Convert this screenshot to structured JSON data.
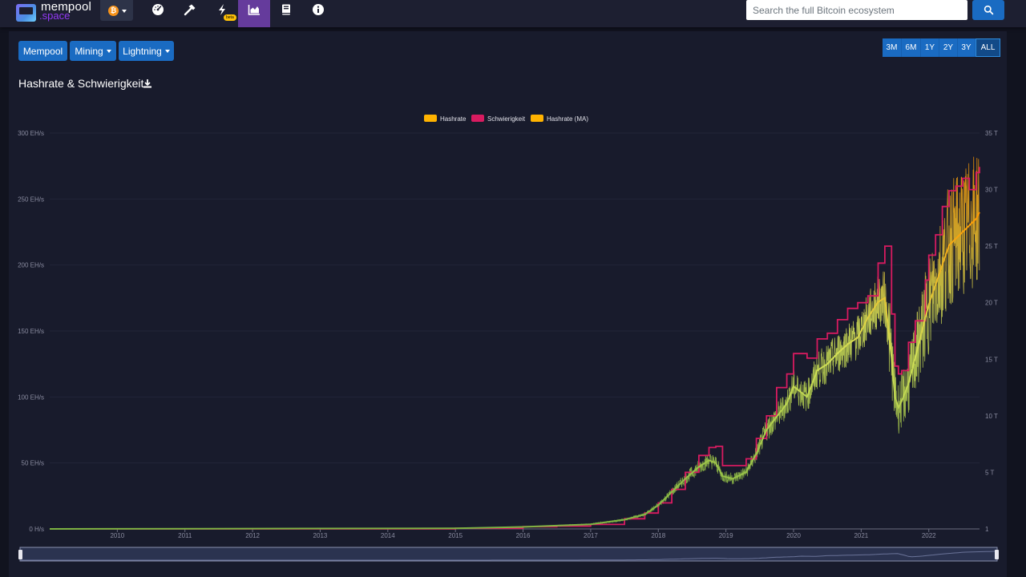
{
  "brand": {
    "name_line1": "mempool",
    "name_line2": ".space"
  },
  "nav": {
    "network_icon_label": "₿",
    "beta_label": "beta"
  },
  "icons": {
    "dashboard": "gauge-icon",
    "mining": "hammer-icon",
    "lightning": "bolt-icon",
    "graphs": "area-chart-icon",
    "docs": "book-icon",
    "about": "info-icon",
    "search": "search-icon",
    "download": "download-icon"
  },
  "search": {
    "placeholder": "Search the full Bitcoin ecosystem"
  },
  "menus": {
    "mempool": "Mempool",
    "mining": "Mining",
    "lightning": "Lightning"
  },
  "ranges": [
    "3M",
    "6M",
    "1Y",
    "2Y",
    "3Y",
    "ALL"
  ],
  "active_range": "ALL",
  "colors": {
    "hashrate": "#ffb300",
    "difficulty": "#d81b60",
    "ma_start": "#7cb342",
    "ma_end": "#ff9800",
    "nav_active": "#653b9c",
    "button": "#1a6bc2"
  },
  "chart_data": {
    "type": "line",
    "title": "Hashrate & Schwierigkeit",
    "legend": [
      "Hashrate",
      "Schwierigkeit",
      "Hashrate (MA)"
    ],
    "legend_position": "top-center",
    "x_ticks": [
      "2010",
      "2011",
      "2012",
      "2013",
      "2014",
      "2015",
      "2016",
      "2017",
      "2018",
      "2019",
      "2020",
      "2021",
      "2022"
    ],
    "y_left_ticks": [
      "0 H/s",
      "50 EH/s",
      "100 EH/s",
      "150 EH/s",
      "200 EH/s",
      "250 EH/s",
      "300 EH/s"
    ],
    "y_right_ticks": [
      "1",
      "5 T",
      "10 T",
      "15 T",
      "20 T",
      "25 T",
      "30 T",
      "35 T"
    ],
    "y_left_range": [
      0,
      300
    ],
    "y_right_range": [
      0,
      35
    ],
    "x_range": [
      2009.0,
      2022.75
    ],
    "hashrate_ma": {
      "name": "Hashrate (MA)",
      "unit": "EH/s",
      "x": [
        2009.0,
        2015.0,
        2016.0,
        2016.5,
        2017.0,
        2017.5,
        2017.8,
        2018.0,
        2018.2,
        2018.4,
        2018.6,
        2018.75,
        2018.85,
        2018.95,
        2019.1,
        2019.3,
        2019.45,
        2019.6,
        2019.75,
        2019.9,
        2020.0,
        2020.2,
        2020.35,
        2020.5,
        2020.65,
        2020.8,
        2020.95,
        2021.1,
        2021.25,
        2021.35,
        2021.45,
        2021.5,
        2021.55,
        2021.6,
        2021.7,
        2021.8,
        2021.95,
        2022.0,
        2022.1,
        2022.2,
        2022.3,
        2022.4,
        2022.5,
        2022.6,
        2022.7,
        2022.75
      ],
      "y": [
        0,
        0.4,
        1.5,
        2.5,
        3.5,
        7,
        11,
        18,
        28,
        38,
        47,
        52,
        50,
        40,
        38,
        43,
        57,
        75,
        85,
        95,
        108,
        100,
        120,
        125,
        133,
        140,
        145,
        160,
        172,
        175,
        130,
        100,
        92,
        97,
        110,
        130,
        160,
        170,
        185,
        200,
        215,
        220,
        225,
        230,
        235,
        240
      ]
    },
    "difficulty": {
      "name": "Schwierigkeit",
      "unit": "T",
      "x": [
        2009.0,
        2015.0,
        2016.0,
        2016.5,
        2017.0,
        2017.5,
        2017.8,
        2018.0,
        2018.2,
        2018.4,
        2018.6,
        2018.75,
        2018.85,
        2018.95,
        2019.1,
        2019.3,
        2019.45,
        2019.6,
        2019.75,
        2019.9,
        2020.0,
        2020.2,
        2020.35,
        2020.5,
        2020.65,
        2020.8,
        2020.95,
        2021.1,
        2021.25,
        2021.35,
        2021.45,
        2021.5,
        2021.55,
        2021.6,
        2021.7,
        2021.8,
        2021.95,
        2022.0,
        2022.1,
        2022.2,
        2022.3,
        2022.4,
        2022.5,
        2022.6,
        2022.7,
        2022.75
      ],
      "y": [
        0,
        0.06,
        0.2,
        0.25,
        0.4,
        0.9,
        1.4,
        2.3,
        3.5,
        5,
        6.5,
        7.2,
        7.3,
        5.6,
        5.6,
        6.2,
        8.0,
        10.0,
        12.5,
        13.7,
        15.5,
        15.1,
        16.8,
        17.3,
        18.5,
        19.5,
        20.0,
        20.6,
        23.5,
        25.0,
        19.0,
        14.4,
        13.7,
        14.0,
        16.5,
        18.4,
        22.0,
        24.2,
        26.0,
        28.5,
        29.9,
        30.3,
        31.0,
        30.0,
        31.5,
        32.0
      ]
    }
  }
}
